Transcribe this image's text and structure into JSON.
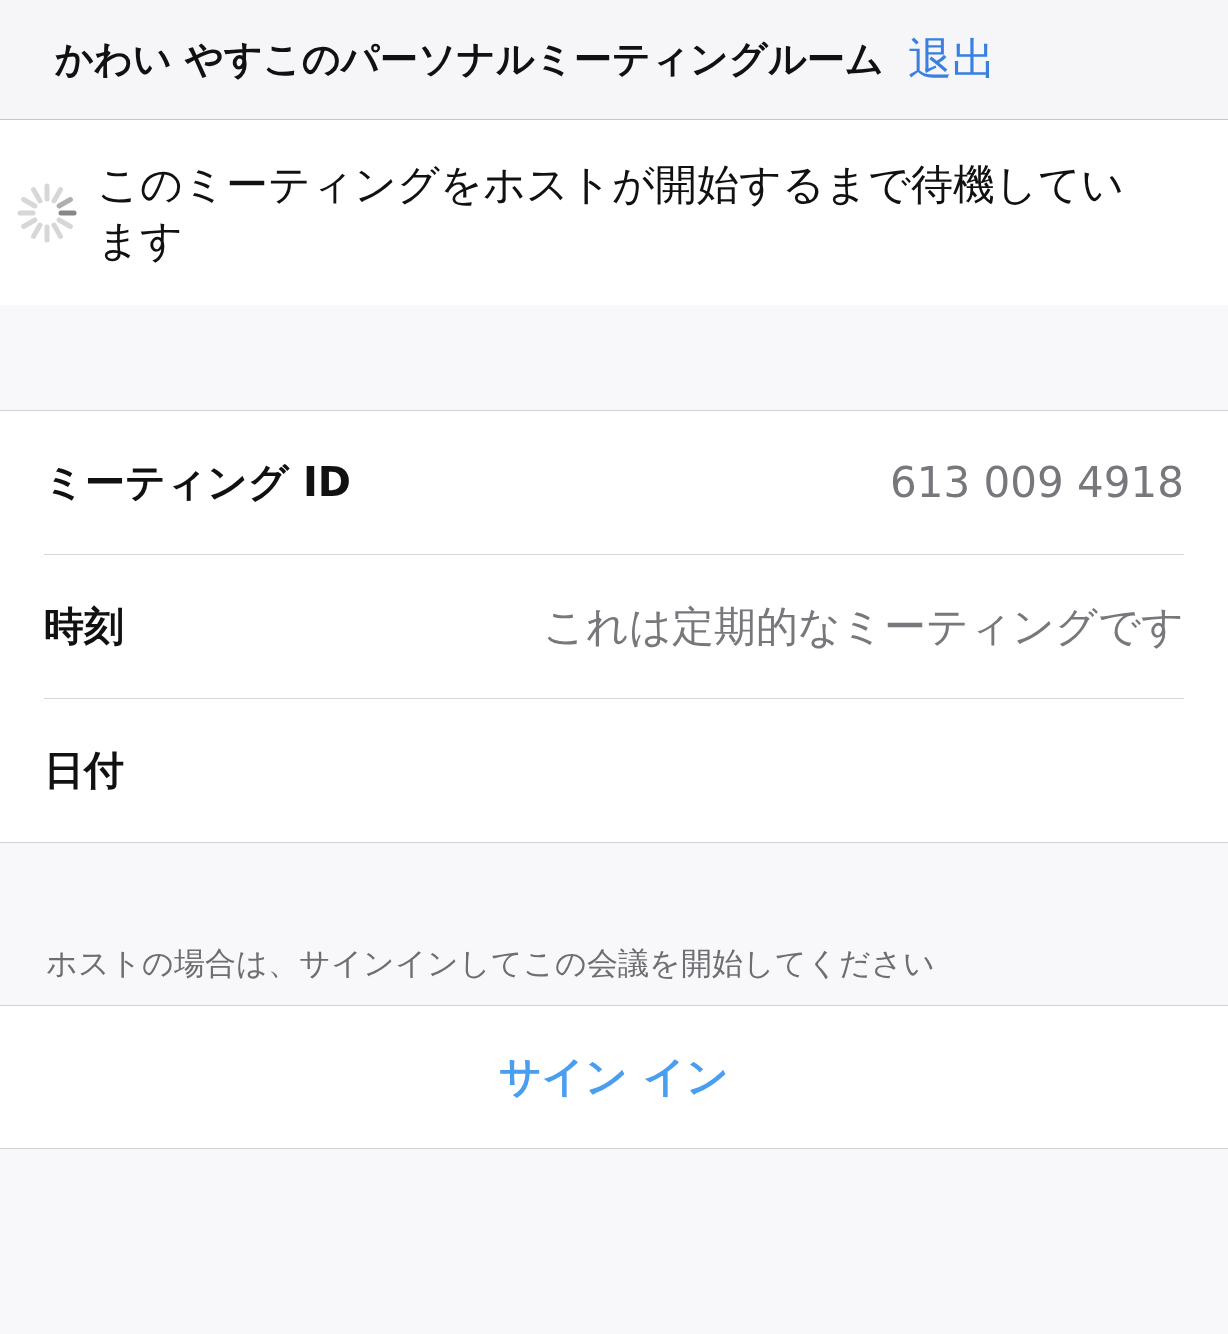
{
  "header": {
    "title": "かわい やすこのパーソナルミーティングルーム",
    "action": "退出"
  },
  "status": {
    "message": "このミーティングをホストが開始するまで待機しています"
  },
  "details": [
    {
      "label": "ミーティング ID",
      "value": "613 009 4918"
    },
    {
      "label": "時刻",
      "value": "これは定期的なミーティングです"
    },
    {
      "label": "日付"
    }
  ],
  "footnote": "ホストの場合は、サインインしてこの会議を開始してください",
  "sign_in_button": "サイン イン"
}
